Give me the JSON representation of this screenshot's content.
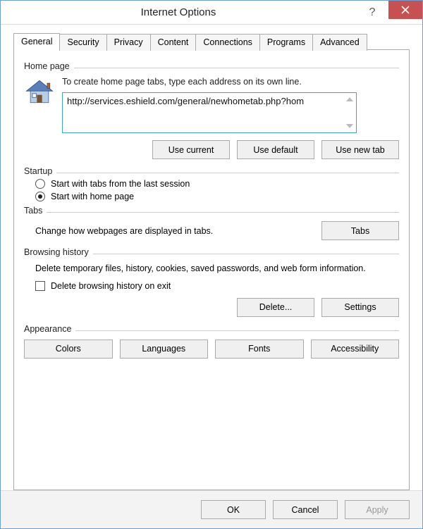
{
  "title": "Internet Options",
  "tabs": [
    "General",
    "Security",
    "Privacy",
    "Content",
    "Connections",
    "Programs",
    "Advanced"
  ],
  "homepage": {
    "group_label": "Home page",
    "instruction": "To create home page tabs, type each address on its own line.",
    "url": "http://services.eshield.com/general/newhometab.php?hom",
    "use_current": "Use current",
    "use_default": "Use default",
    "use_new_tab": "Use new tab"
  },
  "startup": {
    "group_label": "Startup",
    "option_last": "Start with tabs from the last session",
    "option_home": "Start with home page"
  },
  "tabs_section": {
    "group_label": "Tabs",
    "text": "Change how webpages are displayed in tabs.",
    "button": "Tabs"
  },
  "history": {
    "group_label": "Browsing history",
    "text": "Delete temporary files, history, cookies, saved passwords, and web form information.",
    "checkbox_label": "Delete browsing history on exit",
    "delete_btn": "Delete...",
    "settings_btn": "Settings"
  },
  "appearance": {
    "group_label": "Appearance",
    "colors": "Colors",
    "languages": "Languages",
    "fonts": "Fonts",
    "accessibility": "Accessibility"
  },
  "actions": {
    "ok": "OK",
    "cancel": "Cancel",
    "apply": "Apply"
  }
}
